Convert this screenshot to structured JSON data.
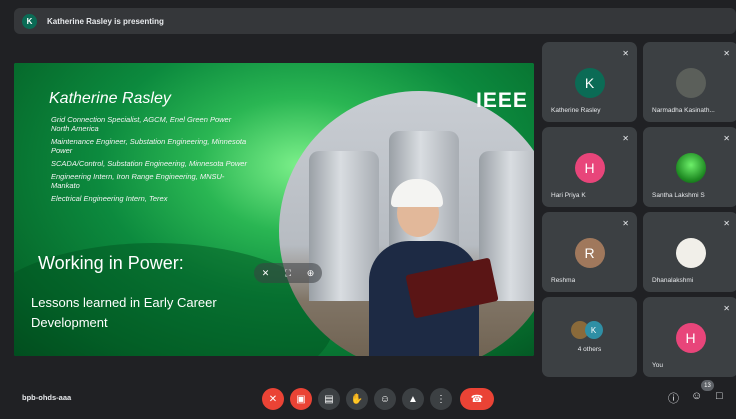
{
  "banner": {
    "avatar_letter": "K",
    "text": "Katherine Rasley is presenting"
  },
  "slide": {
    "logo_text": "IEEE",
    "name": "Katherine Rasley",
    "lines": [
      "Grid Connection Specialist, AGCM, Enel Green Power North America",
      "Maintenance Engineer, Substation Engineering, Minnesota Power",
      "SCADA/Control, Substation Engineering, Minnesota Power",
      "Engineering Intern, Iron Range Engineering, MNSU-Mankato",
      "Electrical Engineering Intern, Terex"
    ],
    "title": "Working in Power:",
    "subtitle": "Lessons learned in Early Career Development"
  },
  "participants": [
    {
      "name": "Katherine Rasley",
      "letter": "K",
      "color": "#0b6b55"
    },
    {
      "name": "Narmadha Kasinath...",
      "letter": "",
      "color": "#5b5f5a"
    },
    {
      "name": "Hari Priya K",
      "letter": "H",
      "color": "#e8457a"
    },
    {
      "name": "Santha Lakshmi S",
      "letter": "",
      "color": "#2e9a30"
    },
    {
      "name": "Reshma",
      "letter": "R",
      "color": "#a0785c"
    },
    {
      "name": "Dhanalakshmi",
      "letter": "",
      "color": "#f1efe9"
    },
    {
      "name": "4 others",
      "letter": "K",
      "color": "#2f8fa5"
    },
    {
      "name": "You",
      "letter": "H",
      "color": "#e8457a"
    }
  ],
  "meeting_code": "bpb-ohds-aaa",
  "people_count": "13",
  "icons": {
    "mic_off": "mic-off-icon",
    "camera_off": "camera-off-icon",
    "captions": "captions-icon",
    "raise_hand": "hand-icon",
    "emoji": "emoji-icon",
    "present": "present-icon",
    "more": "more-icon",
    "end_call": "end-call-icon",
    "info": "info-icon",
    "people": "people-icon",
    "chat": "chat-icon"
  }
}
